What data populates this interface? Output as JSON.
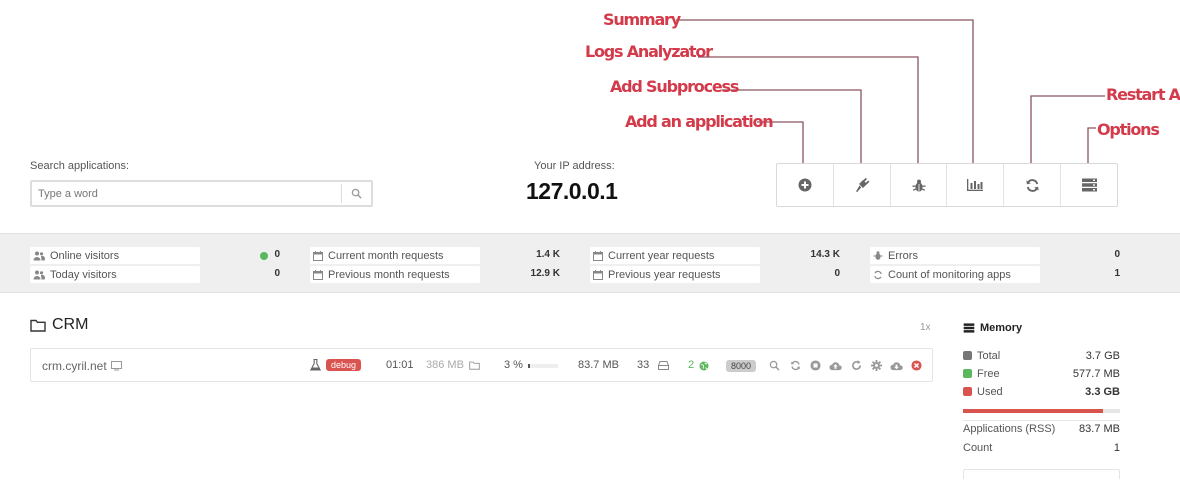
{
  "callouts": {
    "summary": "Summary",
    "logs": "Logs Analyzator",
    "subprocess": "Add Subprocess",
    "add_app": "Add an application",
    "restart": "Restart All",
    "options": "Options"
  },
  "search": {
    "label": "Search applications:",
    "placeholder": "Type a word"
  },
  "ip": {
    "label": "Your IP address:",
    "value": "127.0.0.1"
  },
  "toolbar": [
    {
      "name": "add-application",
      "icon": "plus-circle-icon"
    },
    {
      "name": "add-subprocess",
      "icon": "plug-icon"
    },
    {
      "name": "logs-analyzator",
      "icon": "bug-icon"
    },
    {
      "name": "summary",
      "icon": "bar-chart-icon"
    },
    {
      "name": "restart-all",
      "icon": "refresh-icon"
    },
    {
      "name": "options",
      "icon": "server-icon"
    }
  ],
  "stats": {
    "online_visitors": {
      "label": "Online visitors",
      "value": "0"
    },
    "today_visitors": {
      "label": "Today visitors",
      "value": "0"
    },
    "current_month": {
      "label": "Current month requests",
      "value": "1.4 K"
    },
    "previous_month": {
      "label": "Previous month requests",
      "value": "12.9 K"
    },
    "current_year": {
      "label": "Current year requests",
      "value": "14.3 K"
    },
    "previous_year": {
      "label": "Previous year requests",
      "value": "0"
    },
    "errors": {
      "label": "Errors",
      "value": "0"
    },
    "monitoring_apps": {
      "label": "Count of monitoring apps",
      "value": "1"
    }
  },
  "group": {
    "name": "CRM",
    "count": "1x",
    "apps": [
      {
        "name": "crm.cyril.net",
        "mode": "debug",
        "uptime": "01:01",
        "size": "386 MB",
        "cpu": "3 %",
        "cpu_fraction": 0.03,
        "memory": "83.7 MB",
        "files": "33",
        "status_count": "2",
        "port": "8000"
      }
    ]
  },
  "memory": {
    "title": "Memory",
    "total": {
      "label": "Total",
      "value": "3.7 GB",
      "color": "#777777"
    },
    "free": {
      "label": "Free",
      "value": "577.7 MB",
      "color": "#5cb85c"
    },
    "used": {
      "label": "Used",
      "value": "3.3 GB",
      "color": "#d9534f"
    },
    "used_fraction": 0.89,
    "rss": {
      "label": "Applications (RSS)",
      "value": "83.7 MB"
    },
    "count": {
      "label": "Count",
      "value": "1"
    }
  },
  "colors": {
    "accent": "#d33a4a",
    "danger": "#d9534f",
    "success": "#5cb85c"
  }
}
